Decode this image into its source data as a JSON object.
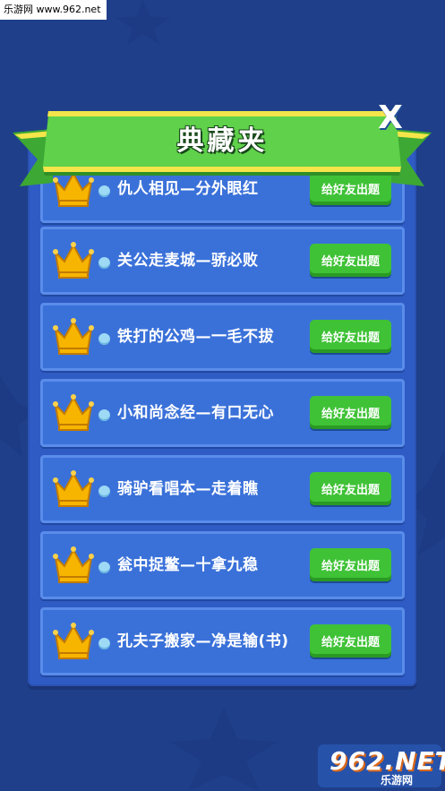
{
  "watermark": {
    "text": "乐游网 www.962.net"
  },
  "dialog": {
    "title": "典藏夹",
    "close_label": "X"
  },
  "items": [
    {
      "text": "仇人相见—分外眼红",
      "button": "给好友出题"
    },
    {
      "text": "关公走麦城—骄必败",
      "button": "给好友出题"
    },
    {
      "text": "铁打的公鸡—一毛不拔",
      "button": "给好友出题"
    },
    {
      "text": "小和尚念经—有口无心",
      "button": "给好友出题"
    },
    {
      "text": "骑驴看唱本—走着瞧",
      "button": "给好友出题"
    },
    {
      "text": "瓮中捉鳖—十拿九稳",
      "button": "给好友出题"
    },
    {
      "text": "孔夫子搬家—净是输(书)",
      "button": "给好友出题"
    }
  ],
  "logo": {
    "main": "962.NET",
    "sub": "乐游网"
  },
  "colors": {
    "background": "#1f3f8a",
    "panel": "#2f5bc4",
    "row": "#3a71d9",
    "button": "#3fc236",
    "banner": "#5fd14a",
    "crown": "#f7b500"
  }
}
